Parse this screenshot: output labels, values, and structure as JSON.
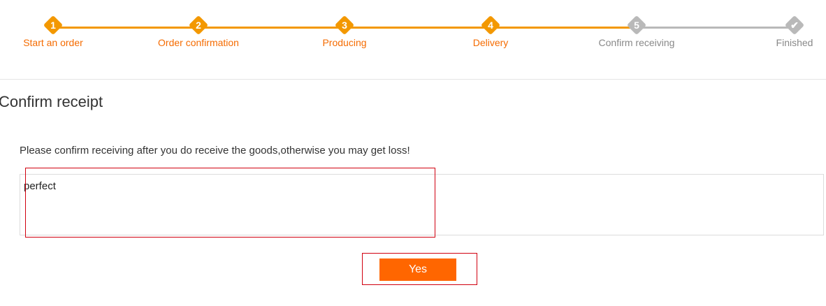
{
  "progress": {
    "active_color": "#f39800",
    "inactive_color": "#b9b9b9",
    "steps": [
      {
        "number": "1",
        "label": "Start an order",
        "state": "done"
      },
      {
        "number": "2",
        "label": "Order confirmation",
        "state": "done"
      },
      {
        "number": "3",
        "label": "Producing",
        "state": "done"
      },
      {
        "number": "4",
        "label": "Delivery",
        "state": "done"
      },
      {
        "number": "5",
        "label": "Confirm receiving",
        "state": "pending"
      },
      {
        "number": "✔",
        "label": "Finished",
        "state": "pending"
      }
    ]
  },
  "section": {
    "title": "Confirm receipt",
    "notice": "Please confirm receiving after you do receive the goods,otherwise you may get loss!"
  },
  "feedback": {
    "value": "perfect"
  },
  "actions": {
    "yes_label": "Yes",
    "button_color": "#ff6600"
  },
  "icons": {
    "final_step": "checkmark-icon"
  }
}
